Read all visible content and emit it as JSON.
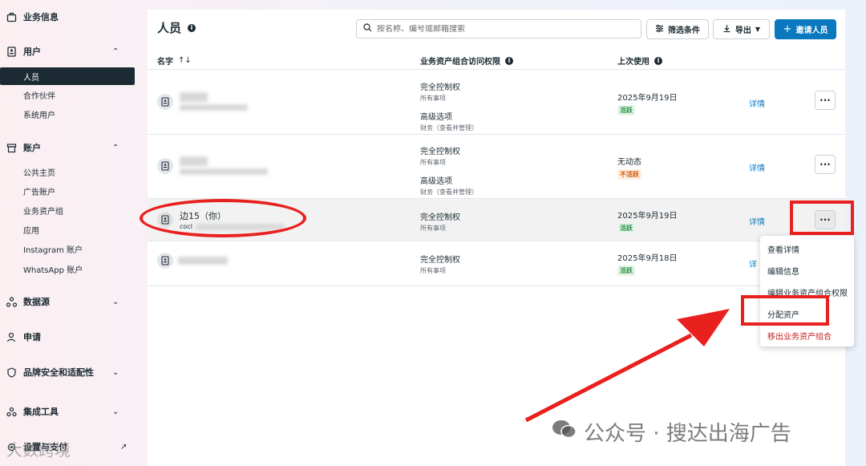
{
  "sidebar": {
    "business_info": "业务信息",
    "users": {
      "label": "用户",
      "items": [
        "人员",
        "合作伙伴",
        "系统用户"
      ]
    },
    "accounts": {
      "label": "账户",
      "items": [
        "公共主页",
        "广告账户",
        "业务资产组",
        "应用",
        "Instagram 账户",
        "WhatsApp 账户"
      ]
    },
    "data_sources": "数据源",
    "requests": "申请",
    "brand_safety": "品牌安全和适配性",
    "integrations": "集成工具",
    "settings_partial": "设置与支付"
  },
  "header": {
    "title": "人员",
    "search_placeholder": "按名称、编号或邮箱搜索",
    "filter_label": "筛选条件",
    "export_label": "导出",
    "invite_label": "邀请人员"
  },
  "columns": {
    "name": "名字",
    "access": "业务资产组合访问权限",
    "last_used": "上次使用"
  },
  "rows": [
    {
      "perm1": "完全控制权",
      "perm1_sub": "所有事项",
      "perm2": "高级选项",
      "perm2_sub": "财务（查看并管理）",
      "last": "2025年9月19日",
      "status": "活跃",
      "status_color": "#1e8e3e",
      "detail": "详情"
    },
    {
      "perm1": "完全控制权",
      "perm1_sub": "所有事项",
      "perm2": "高级选项",
      "perm2_sub": "财务（查看并管理）",
      "last": "无动态",
      "status": "不活跃",
      "status_color": "#d35400",
      "detail": "详情"
    },
    {
      "name": "边15（你）",
      "email_partial": "cocl",
      "perm1": "完全控制权",
      "perm1_sub": "所有事项",
      "last": "2025年9月19日",
      "status": "活跃",
      "status_color": "#1e8e3e",
      "detail": "详情"
    },
    {
      "perm1": "完全控制权",
      "perm1_sub": "所有事项",
      "last": "2025年9月18日",
      "status": "活跃",
      "status_color": "#1e8e3e",
      "detail": "详"
    }
  ],
  "more_label": "···",
  "menu": {
    "view_details": "查看详情",
    "edit_info": "编辑信息",
    "edit_portfolio": "编辑业务资产组合权限",
    "assign_assets": "分配资产",
    "remove": "移出业务资产组合"
  },
  "watermark": "公众号 · 搜达出海广告",
  "watermark2": "大数跨境",
  "colors": {
    "primary": "#0a78be",
    "annotation": "#e8201e",
    "dark": "#1c2b33"
  }
}
